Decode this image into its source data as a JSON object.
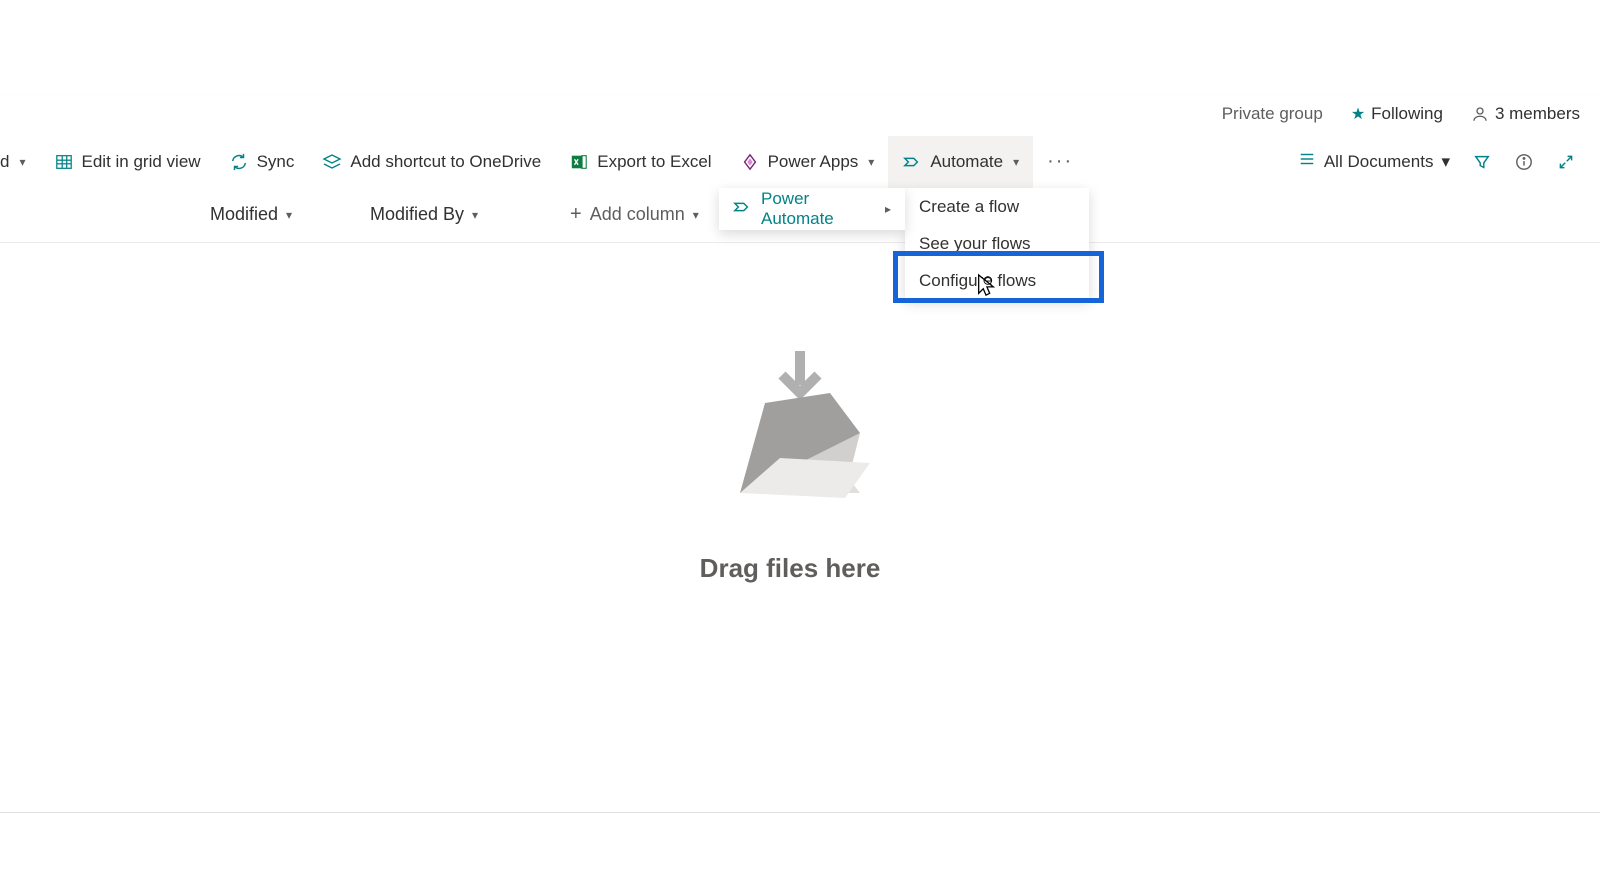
{
  "site": {
    "group_privacy": "Private group",
    "following_label": "Following",
    "members_label": "3 members"
  },
  "commands": {
    "partial_first": "d",
    "edit_grid": "Edit in grid view",
    "sync": "Sync",
    "shortcut": "Add shortcut to OneDrive",
    "export": "Export to Excel",
    "power_apps": "Power Apps",
    "automate": "Automate",
    "more": "···"
  },
  "right": {
    "view_name": "All Documents"
  },
  "flyout1": {
    "power_automate": "Power Automate"
  },
  "flyout2": {
    "create_flow": "Create a flow",
    "see_flows": "See your flows",
    "configure_flows": "Configure flows"
  },
  "columns": {
    "modified": "Modified",
    "modified_by": "Modified By",
    "add_column": "Add column"
  },
  "empty": {
    "drag": "Drag files here"
  }
}
